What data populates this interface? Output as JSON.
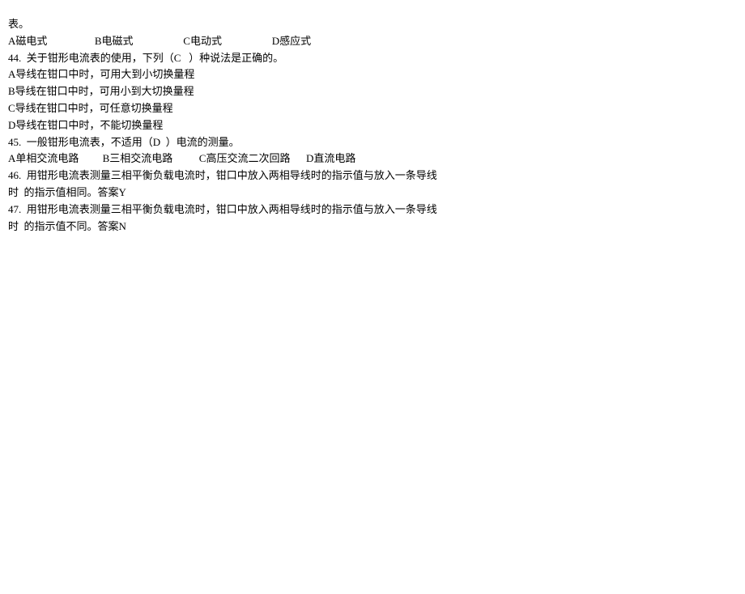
{
  "lines": {
    "l0": "表。",
    "l1": "A磁电式                  B电磁式                   C电动式                   D感应式",
    "l2": "44.  关于钳形电流表的使用，下列（C   ）种说法是正确的。",
    "l3": "A导线在钳口中时，可用大到小切换量程",
    "l4": "B导线在钳口中时，可用小到大切换量程",
    "l5": "C导线在钳口中时，可任意切换量程",
    "l6": "D导线在钳口中时，不能切换量程",
    "l7": "45.  一般钳形电流表，不适用（D  ）电流的测量。",
    "l8": "A单相交流电路         B三相交流电路          C高压交流二次回路      D直流电路",
    "l9": "46.  用钳形电流表测量三相平衡负载电流时，钳口中放入两相导线时的指示值与放入一条导线",
    "l10": "时  的指示值相同。答案Y",
    "l11": "47.  用钳形电流表测量三相平衡负载电流时，钳口中放入两相导线时的指示值与放入一条导线",
    "l12": "时  的指示值不同。答案N"
  }
}
